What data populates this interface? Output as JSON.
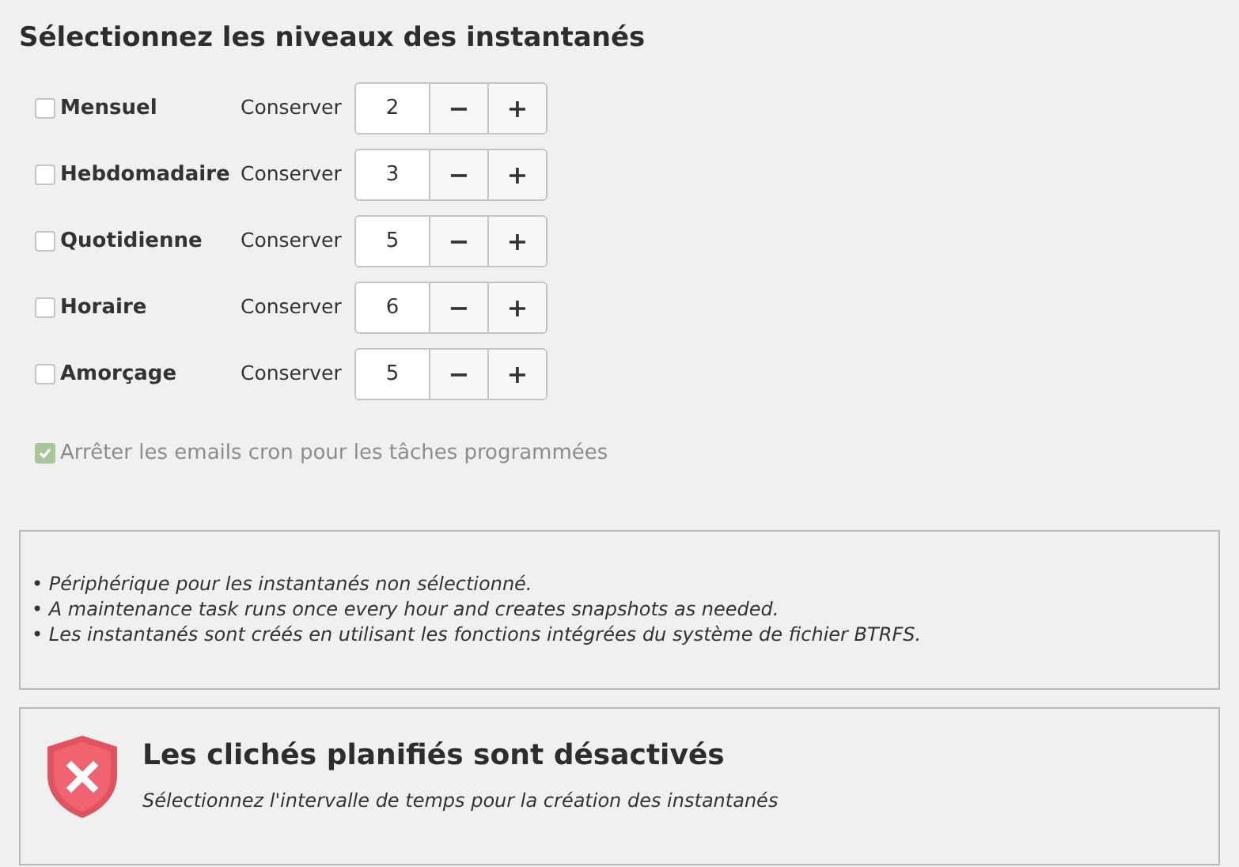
{
  "title": "Sélectionnez les niveaux des instantanés",
  "levels": [
    {
      "label": "Mensuel",
      "checked": false,
      "keep_label": "Conserver",
      "value": "2",
      "decrement": "−",
      "increment": "+"
    },
    {
      "label": "Hebdomadaire",
      "checked": false,
      "keep_label": "Conserver",
      "value": "3",
      "decrement": "−",
      "increment": "+"
    },
    {
      "label": "Quotidienne",
      "checked": false,
      "keep_label": "Conserver",
      "value": "5",
      "decrement": "−",
      "increment": "+"
    },
    {
      "label": "Horaire",
      "checked": false,
      "keep_label": "Conserver",
      "value": "6",
      "decrement": "−",
      "increment": "+"
    },
    {
      "label": "Amorçage",
      "checked": false,
      "keep_label": "Conserver",
      "value": "5",
      "decrement": "−",
      "increment": "+"
    }
  ],
  "cron_option": {
    "label": "Arrêter les emails cron pour les tâches programmées",
    "checked": true,
    "disabled": true
  },
  "notes": [
    "• Périphérique pour les instantanés non sélectionné.",
    "• A maintenance task runs once every hour and creates snapshots as needed.",
    "• Les instantanés sont créés en utilisant les fonctions intégrées du système de fichier BTRFS."
  ],
  "status": {
    "title": "Les clichés planifiés sont désactivés",
    "message": "Sélectionnez l'intervalle de temps pour la création des instantanés"
  }
}
